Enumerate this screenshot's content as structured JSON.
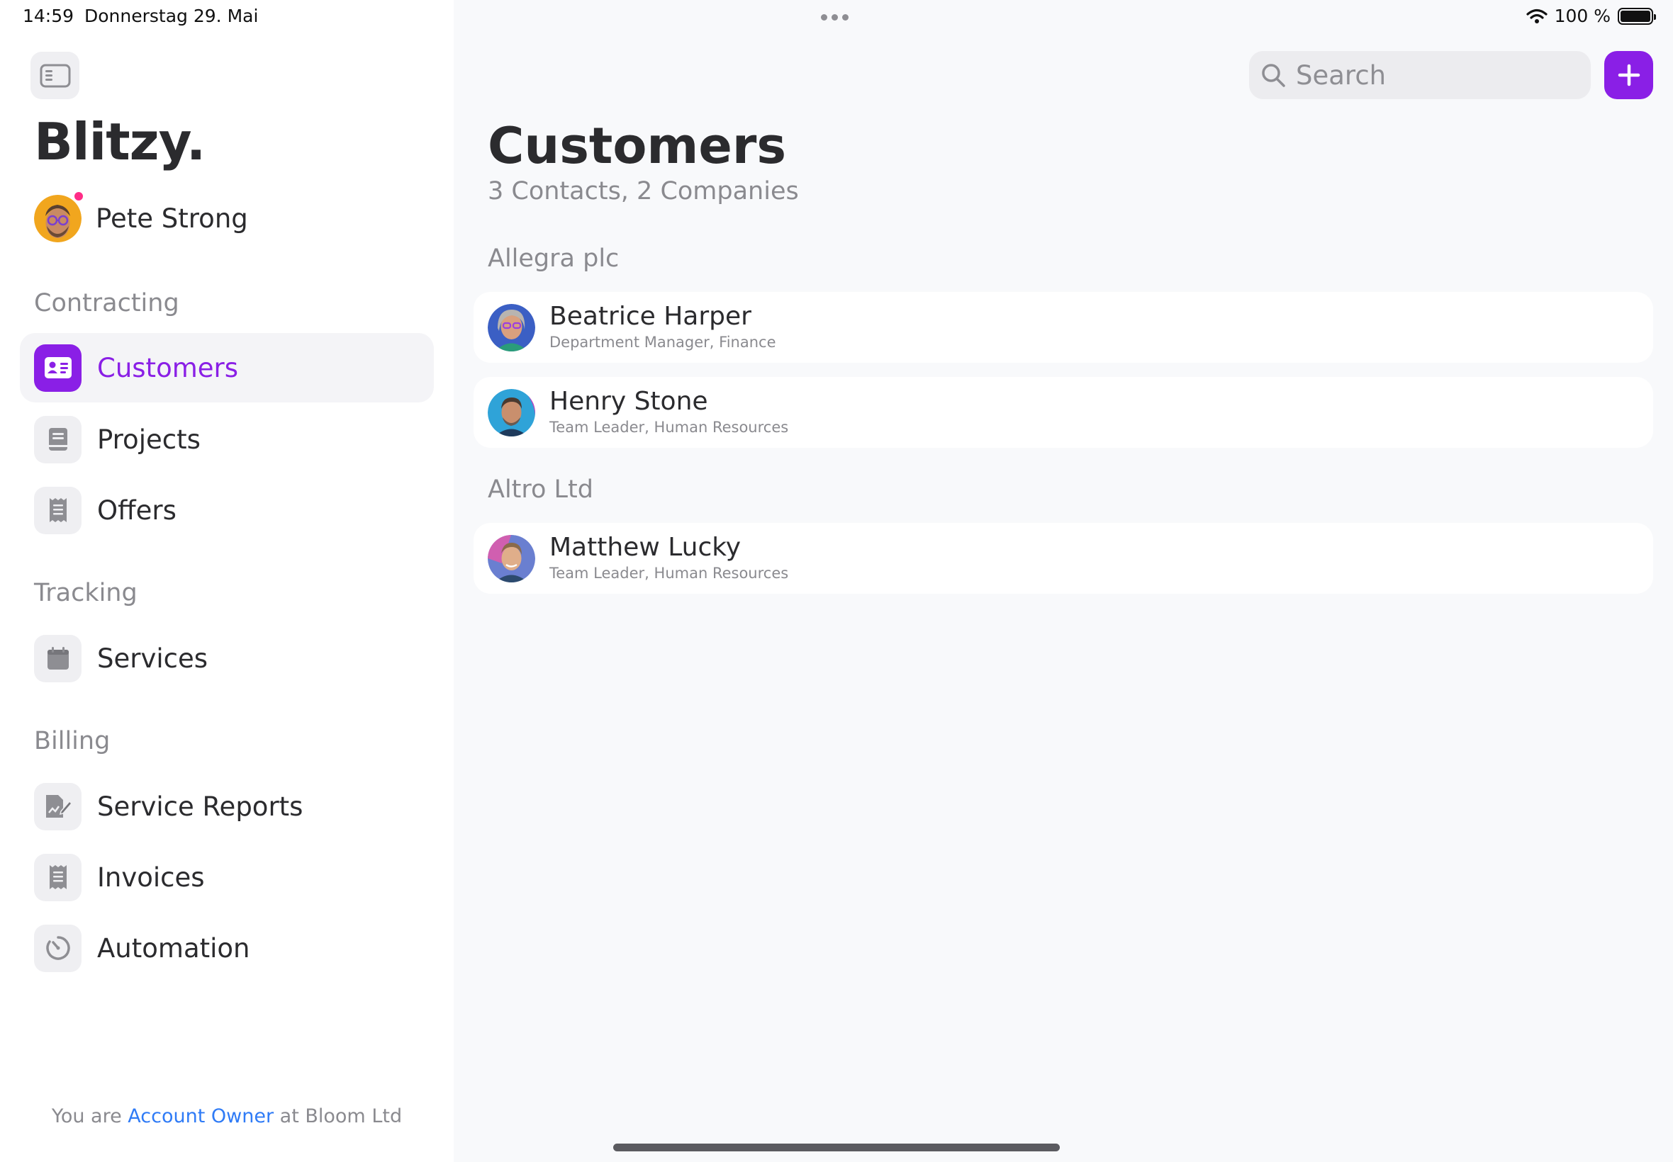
{
  "status_bar": {
    "time": "14:59",
    "date": "Donnerstag 29. Mai",
    "battery": "100 %",
    "battery_level": 1.0
  },
  "sidebar": {
    "brand": "Blitzy.",
    "user_name": "Pete Strong",
    "sections": [
      {
        "label": "Contracting"
      },
      {
        "label": "Tracking"
      },
      {
        "label": "Billing"
      }
    ],
    "items": [
      {
        "label": "Customers",
        "icon": "contact-card-icon",
        "active": true
      },
      {
        "label": "Projects",
        "icon": "book-icon"
      },
      {
        "label": "Offers",
        "icon": "receipt-icon"
      },
      {
        "label": "Services",
        "icon": "calendar-icon"
      },
      {
        "label": "Service Reports",
        "icon": "report-edit-icon"
      },
      {
        "label": "Invoices",
        "icon": "receipt-icon"
      },
      {
        "label": "Automation",
        "icon": "timer-icon"
      }
    ],
    "footer": {
      "prefix": "You are",
      "role": "Account Owner",
      "suffix": "at Bloom Ltd"
    }
  },
  "search": {
    "placeholder": "Search"
  },
  "main": {
    "title": "Customers",
    "subtitle": "3 Contacts, 2 Companies",
    "groups": [
      {
        "company": "Allegra plc",
        "contacts": [
          {
            "name": "Beatrice Harper",
            "role": "Department Manager, Finance"
          },
          {
            "name": "Henry Stone",
            "role": "Team Leader, Human Resources"
          }
        ]
      },
      {
        "company": "Altro Ltd",
        "contacts": [
          {
            "name": "Matthew Lucky",
            "role": "Team Leader, Human Resources"
          }
        ]
      }
    ]
  },
  "colors": {
    "accent": "#8a1fe6",
    "link": "#2f7bf6",
    "notification": "#ff2d87"
  }
}
